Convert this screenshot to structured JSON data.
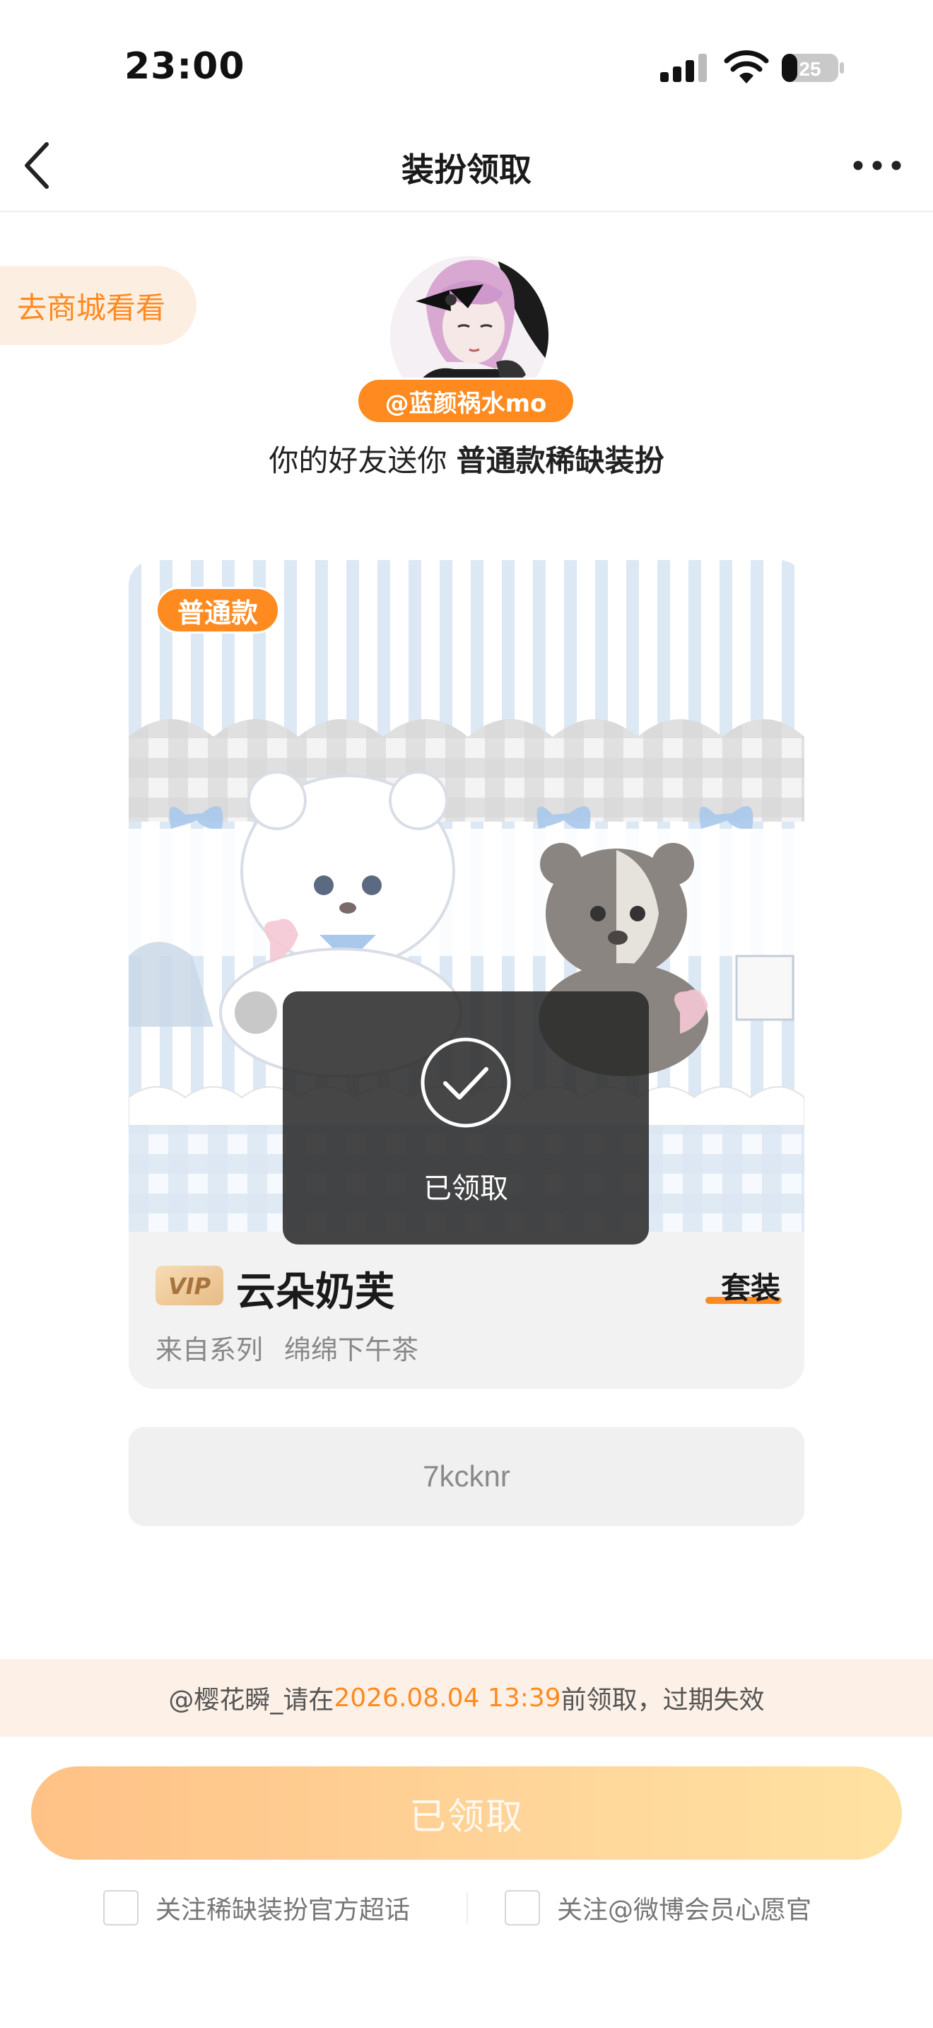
{
  "status_bar": {
    "time": "23:00",
    "battery": "25"
  },
  "nav": {
    "title": "装扮领取",
    "back_icon": "chevron-left-icon",
    "more_icon": "more-dots-icon"
  },
  "shop_link": "去商城看看",
  "sender": {
    "name": "@蓝颜祸水mo"
  },
  "gift_message": {
    "prefix": "你的好友送你 ",
    "item_type": "普通款稀缺装扮"
  },
  "card": {
    "tag": "普通款",
    "vip_badge": "VIP",
    "item_name": "云朵奶芙",
    "suit_label": "套装",
    "series_label": "来自系列",
    "series_name": "绵绵下午茶"
  },
  "toast": {
    "text": "已领取"
  },
  "code": "7kcknr",
  "deadline": {
    "prefix": "@樱花瞬_请在",
    "date": "2026.08.04 13:39",
    "suffix": "前领取，过期失效"
  },
  "claim_button": "已领取",
  "follow_options": [
    {
      "label": "关注稀缺装扮官方超话",
      "checked": false
    },
    {
      "label": "关注@微博会员心愿官",
      "checked": false
    }
  ],
  "colors": {
    "accent": "#ff8a1f",
    "deadline_bg": "#fdf0e6",
    "button_start": "#ffc186",
    "button_end": "#ffe2a2"
  }
}
